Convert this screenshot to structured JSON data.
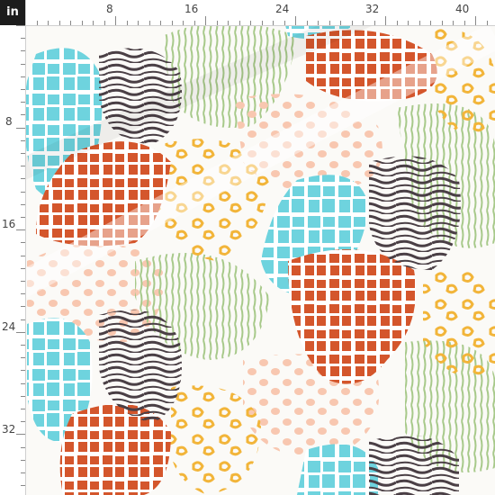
{
  "ruler": {
    "unit": "in",
    "top_labels": [
      "8",
      "16",
      "24",
      "32",
      "40"
    ],
    "left_labels": [
      "8",
      "16",
      "24",
      "32"
    ]
  },
  "colors": {
    "turquoise": "#6ed3de",
    "rust": "#d4562c",
    "zebra_stripe": "#4a3f45",
    "sage": "#a7c98a",
    "peach": "#f8c7b0",
    "mustard": "#f2b53a",
    "background": "#fbfaf7"
  },
  "icons": [
    "giraffe-print",
    "zebra-print",
    "leopard-print",
    "tiger-stripe-print",
    "dot-print"
  ]
}
